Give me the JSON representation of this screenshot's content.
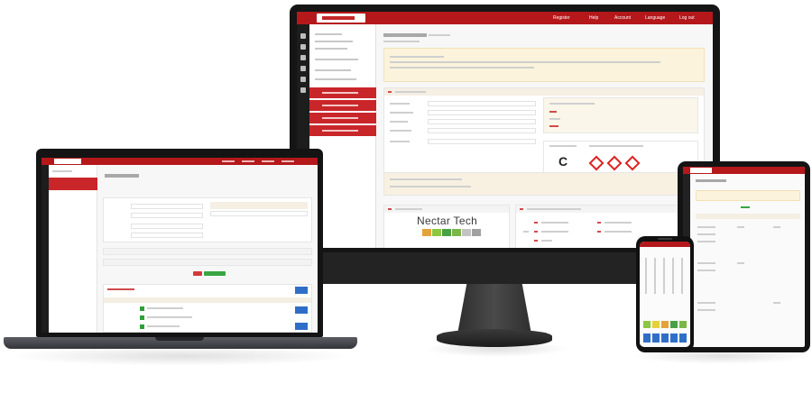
{
  "monitor": {
    "nav": [
      "Register",
      "Help",
      "Account",
      "Language",
      "Log out"
    ],
    "hero_text": "Nectar Tech",
    "swatch_colors": [
      "#e5a23b",
      "#8ec63f",
      "#4aa046",
      "#7ab648",
      "#c3c3c3",
      "#a1a1a1"
    ]
  },
  "colors": {
    "brand_red": "#b4181b",
    "dark_bezel": "#151515",
    "accent_blue": "#2f6ec7",
    "accent_green": "#2e9f3a",
    "notice_bg": "#fbf3dc"
  }
}
